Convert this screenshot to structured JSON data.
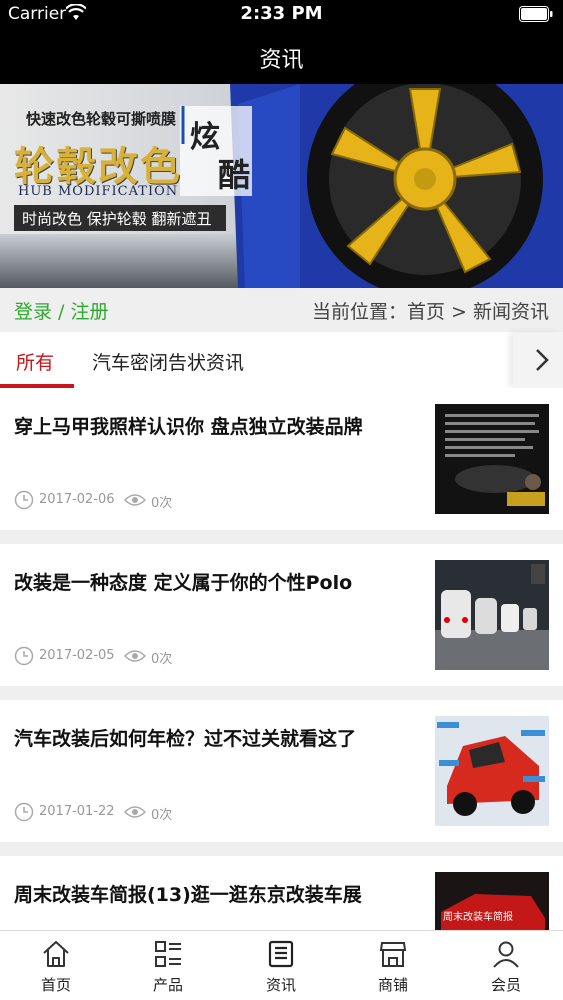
{
  "status_bar": {
    "carrier": "Carrier",
    "time": "2:33 PM"
  },
  "nav": {
    "title": "资讯"
  },
  "banner": {
    "tagline": "快速改色轮毂可撕喷膜",
    "headline": "轮毂改色",
    "english": "HUB MODIFICATION",
    "slogan": "时尚改色 保护轮毂 翻新遮丑",
    "word1": "炫",
    "word2": "酷"
  },
  "breadcrumb": {
    "login_register": "登录 / 注册",
    "location": "当前位置：首页 > 新闻资讯"
  },
  "tabs": {
    "items": [
      {
        "label": "所有"
      },
      {
        "label": "汽车密闭告状资讯"
      }
    ]
  },
  "articles": [
    {
      "title": "穿上马甲我照样认识你 盘点独立改装品牌",
      "date": "2017-02-06",
      "views": "0次"
    },
    {
      "title": "改装是一种态度 定义属于你的个性Polo",
      "date": "2017-02-05",
      "views": "0次"
    },
    {
      "title": "汽车改装后如何年检？过不过关就看这了",
      "date": "2017-01-22",
      "views": "0次"
    },
    {
      "title": "周末改装车简报(13)逛一逛东京改装车展",
      "date": "",
      "views": ""
    }
  ],
  "thumb_text": {
    "article4": "周末改装车简报"
  },
  "tabbar": {
    "items": [
      {
        "label": "首页",
        "icon": "home-icon"
      },
      {
        "label": "产品",
        "icon": "grid-list-icon"
      },
      {
        "label": "资讯",
        "icon": "news-icon"
      },
      {
        "label": "商铺",
        "icon": "store-icon"
      },
      {
        "label": "会员",
        "icon": "user-icon"
      }
    ]
  },
  "colors": {
    "accent": "#c8161d",
    "login_green": "#2eaa2e"
  }
}
